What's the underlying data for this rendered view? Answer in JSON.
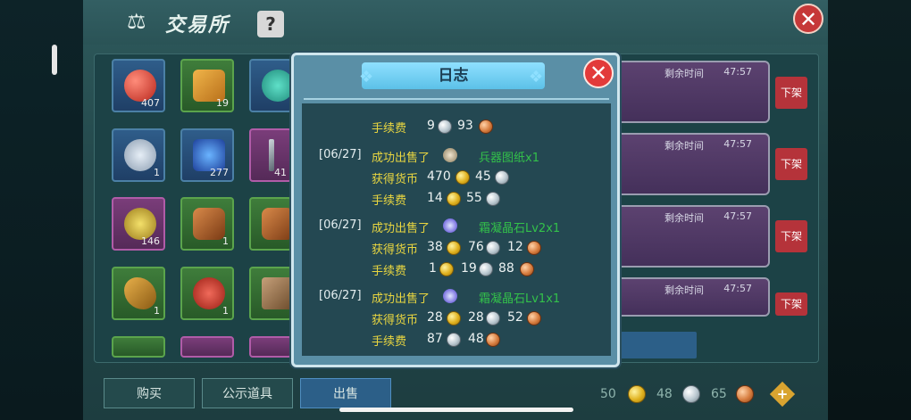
{
  "window": {
    "title": "交易所",
    "help_label": "?",
    "close_label": "✕"
  },
  "inventory": [
    {
      "count": "407",
      "color": "blue"
    },
    {
      "count": "19",
      "color": "green"
    },
    {
      "count": "",
      "color": "blue"
    },
    {
      "count": "1",
      "color": "blue"
    },
    {
      "count": "277",
      "color": "blue"
    },
    {
      "count": "41",
      "color": "purple"
    },
    {
      "count": "146",
      "color": "purple"
    },
    {
      "count": "1",
      "color": "green"
    },
    {
      "count": "",
      "color": "green"
    },
    {
      "count": "1",
      "color": "green"
    },
    {
      "count": "1",
      "color": "green"
    },
    {
      "count": "",
      "color": "green"
    }
  ],
  "sale_list": {
    "time_label": "剩余时间",
    "time_value": "47:57",
    "off_shelf_label": "下架",
    "rows": 4
  },
  "tabs": {
    "buy": "购买",
    "public": "公示道具",
    "sell": "出售"
  },
  "currency": {
    "gold": "50",
    "silver": "48",
    "copper": "65",
    "add_label": "+"
  },
  "dialog": {
    "title": "日志",
    "close_label": "✕",
    "fee_label": "手续费",
    "earn_label": "获得货币",
    "entries": [
      {
        "fee": {
          "silver": "9",
          "copper": "93"
        }
      },
      {
        "date": "[06/27]",
        "action": "成功出售了",
        "item": "兵器图纸x1",
        "earn": {
          "gold": "470",
          "silver": "45"
        },
        "fee": {
          "gold": "14",
          "silver": "55"
        }
      },
      {
        "date": "[06/27]",
        "action": "成功出售了",
        "item": "霜凝晶石Lv2x1",
        "earn": {
          "gold": "38",
          "silver": "76",
          "copper": "12"
        },
        "fee": {
          "gold": "1",
          "silver": "19",
          "copper": "88"
        }
      },
      {
        "date": "[06/27]",
        "action": "成功出售了",
        "item": "霜凝晶石Lv1x1",
        "earn": {
          "gold": "28",
          "silver": "28",
          "copper": "52"
        },
        "fee": {
          "silver": "87",
          "copper": "48"
        }
      }
    ]
  }
}
